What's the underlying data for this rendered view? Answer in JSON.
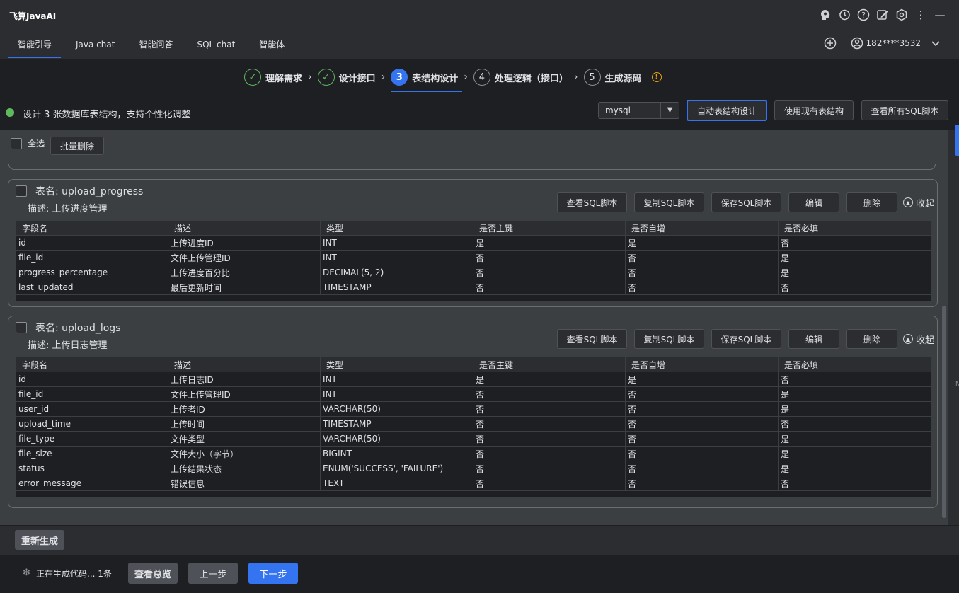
{
  "app": {
    "title": "飞算JavaAI"
  },
  "tabs": [
    "智能引导",
    "Java chat",
    "智能问答",
    "SQL chat",
    "智能体"
  ],
  "user": {
    "phone": "182****3532"
  },
  "steps": [
    {
      "num": "✓",
      "label": "理解需求",
      "state": "done"
    },
    {
      "num": "✓",
      "label": "设计接口",
      "state": "done"
    },
    {
      "num": "3",
      "label": "表结构设计",
      "state": "active"
    },
    {
      "num": "4",
      "label": "处理逻辑（接口）",
      "state": "todo"
    },
    {
      "num": "5",
      "label": "生成源码",
      "state": "todo"
    }
  ],
  "info": {
    "message": "设计 3 张数据库表结构，支持个性化调整",
    "db_type": "mysql",
    "auto_btn": "自动表结构设计",
    "existing_btn": "使用现有表结构",
    "view_all_btn": "查看所有SQL脚本"
  },
  "toolbar": {
    "select_all": "全选",
    "batch_delete": "批量删除"
  },
  "card_actions": {
    "view_sql": "查看SQL脚本",
    "copy_sql": "复制SQL脚本",
    "save_sql": "保存SQL脚本",
    "edit": "编辑",
    "delete": "删除",
    "collapse": "收起"
  },
  "columns": [
    "字段名",
    "描述",
    "类型",
    "是否主键",
    "是否自增",
    "是否必填"
  ],
  "tables": [
    {
      "name": "表名: upload_progress",
      "desc": "描述: 上传进度管理",
      "rows": [
        [
          "id",
          "上传进度ID",
          "INT",
          "是",
          "是",
          "否"
        ],
        [
          "file_id",
          "文件上传管理ID",
          "INT",
          "否",
          "否",
          "是"
        ],
        [
          "progress_percentage",
          "上传进度百分比",
          "DECIMAL(5, 2)",
          "否",
          "否",
          "是"
        ],
        [
          "last_updated",
          "最后更新时间",
          "TIMESTAMP",
          "否",
          "否",
          "否"
        ]
      ]
    },
    {
      "name": "表名: upload_logs",
      "desc": "描述: 上传日志管理",
      "rows": [
        [
          "id",
          "上传日志ID",
          "INT",
          "是",
          "是",
          "否"
        ],
        [
          "file_id",
          "文件上传管理ID",
          "INT",
          "否",
          "否",
          "是"
        ],
        [
          "user_id",
          "上传者ID",
          "VARCHAR(50)",
          "否",
          "否",
          "是"
        ],
        [
          "upload_time",
          "上传时间",
          "TIMESTAMP",
          "否",
          "否",
          "否"
        ],
        [
          "file_type",
          "文件类型",
          "VARCHAR(50)",
          "否",
          "否",
          "是"
        ],
        [
          "file_size",
          "文件大小（字节）",
          "BIGINT",
          "否",
          "否",
          "是"
        ],
        [
          "status",
          "上传结果状态",
          "ENUM('SUCCESS', 'FAILURE')",
          "否",
          "否",
          "是"
        ],
        [
          "error_message",
          "错误信息",
          "TEXT",
          "否",
          "否",
          "否"
        ]
      ]
    }
  ],
  "regen_btn": "重新生成",
  "footer": {
    "status": "正在生成代码... 1条",
    "overview_btn": "查看总览",
    "prev_btn": "上一步",
    "next_btn": "下一步"
  },
  "edge_letter": "N",
  "colors": {
    "accent": "#3574f0",
    "success": "#5fb85f",
    "warning": "#e5a00d"
  }
}
